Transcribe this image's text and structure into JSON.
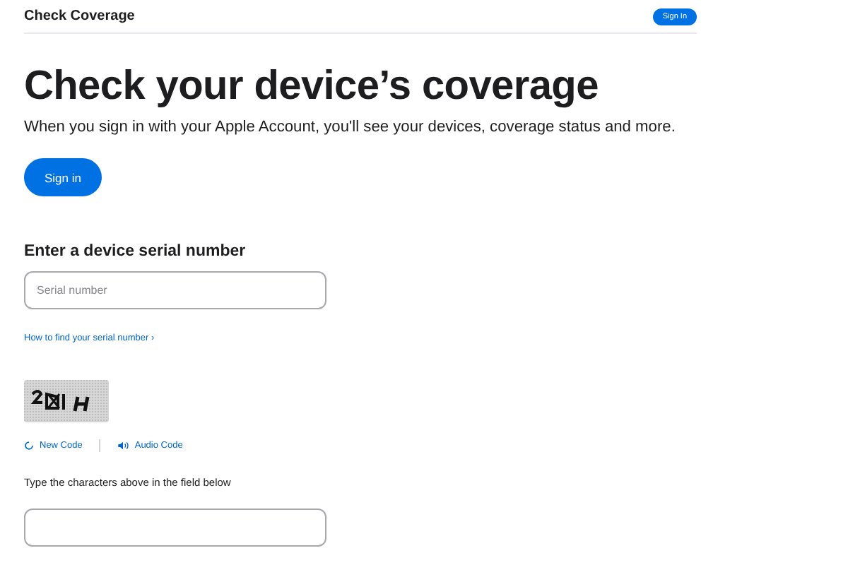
{
  "header": {
    "title": "Check Coverage",
    "sign_in_button": "Sign In"
  },
  "hero": {
    "title": "Check your device’s coverage",
    "subtitle": "When you sign in with your Apple Account, you'll see your devices, coverage status and more.",
    "button": "Sign in"
  },
  "serial": {
    "heading": "Enter a device serial number",
    "placeholder": "Serial number",
    "help_link": "How to find your serial number ›"
  },
  "captcha": {
    "new_code": "New Code",
    "audio_code": "Audio Code",
    "instruction": "Type the characters above in the field below"
  }
}
